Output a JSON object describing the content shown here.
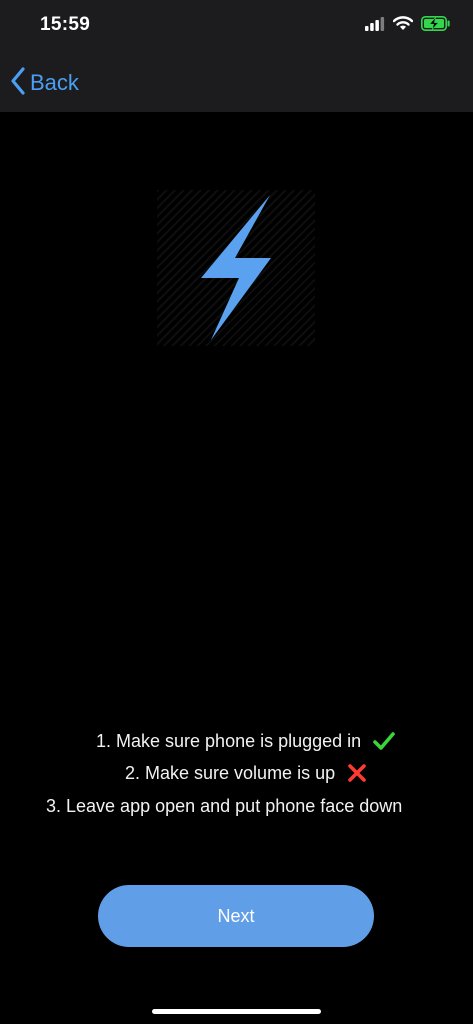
{
  "status_bar": {
    "time": "15:59",
    "icons": [
      "cellular-signal-icon",
      "wifi-icon",
      "battery-charging-icon"
    ],
    "battery_color": "#32d74b"
  },
  "nav": {
    "back_label": "Back",
    "accent_color": "#4a9ff5"
  },
  "hero": {
    "icon": "lightning-bolt-icon",
    "color": "#5aa2f0"
  },
  "instructions": {
    "steps": [
      {
        "text": "1. Make sure phone is plugged in",
        "status": "done",
        "status_icon": "checkmark-icon",
        "status_color": "#3bd43b"
      },
      {
        "text": "2. Make sure volume is up",
        "status": "failed",
        "status_icon": "cross-icon",
        "status_color": "#ff3b30"
      },
      {
        "text": "3. Leave app open and put phone face down"
      }
    ]
  },
  "actions": {
    "next_label": "Next",
    "button_color": "#609fe8"
  }
}
